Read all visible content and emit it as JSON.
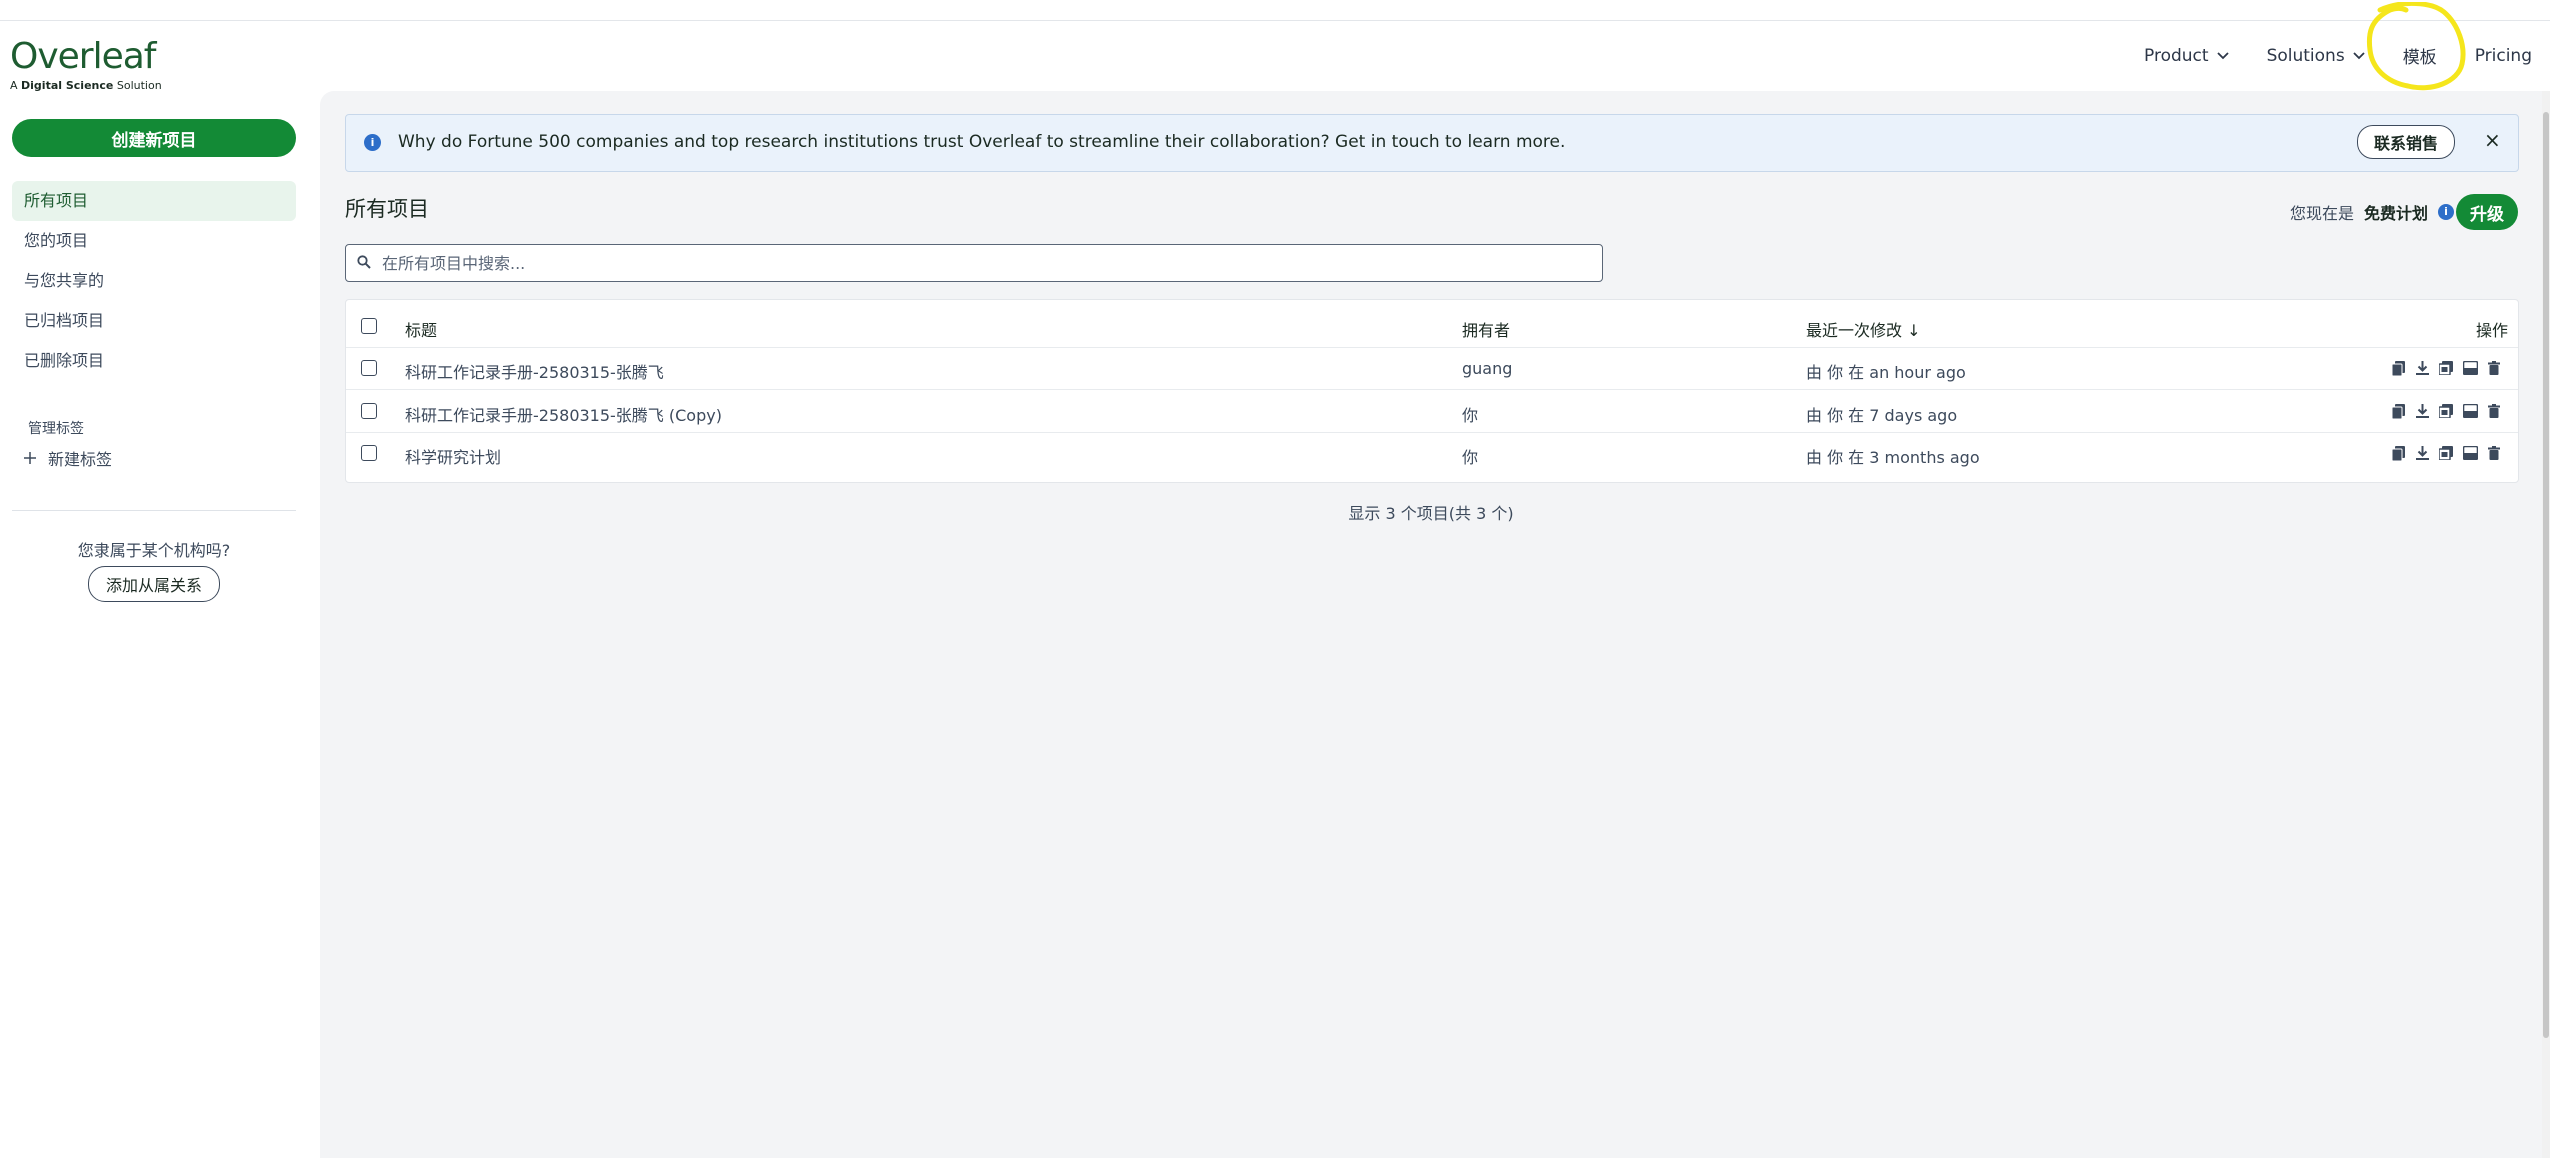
{
  "brand": {
    "logo_text": "Overleaf",
    "sub_prefix": "A ",
    "sub_bold": "Digital Science",
    "sub_suffix": " Solution",
    "color": "#1e5c31"
  },
  "nav": {
    "items": [
      {
        "label": "Product",
        "has_dropdown": true
      },
      {
        "label": "Solutions",
        "has_dropdown": true
      },
      {
        "label": "模板",
        "has_dropdown": false
      },
      {
        "label": "Pricing",
        "has_dropdown": false
      }
    ]
  },
  "sidebar": {
    "new_project": "创建新项目",
    "items": [
      {
        "label": "所有项目",
        "active": true
      },
      {
        "label": "您的项目",
        "active": false
      },
      {
        "label": "与您共享的",
        "active": false
      },
      {
        "label": "已归档项目",
        "active": false
      },
      {
        "label": "已删除项目",
        "active": false
      }
    ],
    "tags_heading": "管理标签",
    "new_tag": "新建标签",
    "org_question": "您隶属于某个机构吗?",
    "org_button": "添加从属关系"
  },
  "banner": {
    "text": "Why do Fortune 500 companies and top research institutions trust Overleaf to streamline their collaboration? Get in touch to learn more.",
    "button": "联系销售",
    "close": "×"
  },
  "main": {
    "title": "所有项目",
    "plan_prefix": "您现在是",
    "plan_name": "免费计划",
    "upgrade": "升级",
    "search_placeholder": "在所有项目中搜索..."
  },
  "table": {
    "headers": {
      "title": "标题",
      "owner": "拥有者",
      "modified": "最近一次修改 ↓",
      "actions": "操作"
    },
    "rows": [
      {
        "title": "科研工作记录手册-2580315-张腾飞",
        "owner": "guang",
        "modified": "由 你 在 an hour ago"
      },
      {
        "title": "科研工作记录手册-2580315-张腾飞 (Copy)",
        "owner": "你",
        "modified": "由 你 在 7 days ago"
      },
      {
        "title": "科学研究计划",
        "owner": "你",
        "modified": "由 你 在 3 months ago"
      }
    ],
    "row_action_icons": [
      "copy-icon",
      "download-icon",
      "download-pdf-icon",
      "archive-icon",
      "trash-icon"
    ]
  },
  "footer": {
    "count_text": "显示 3 个项目(共 3 个)"
  },
  "colors": {
    "accent": "#138a36",
    "info": "#2d6ec9",
    "annotation": "#f5e61c"
  }
}
